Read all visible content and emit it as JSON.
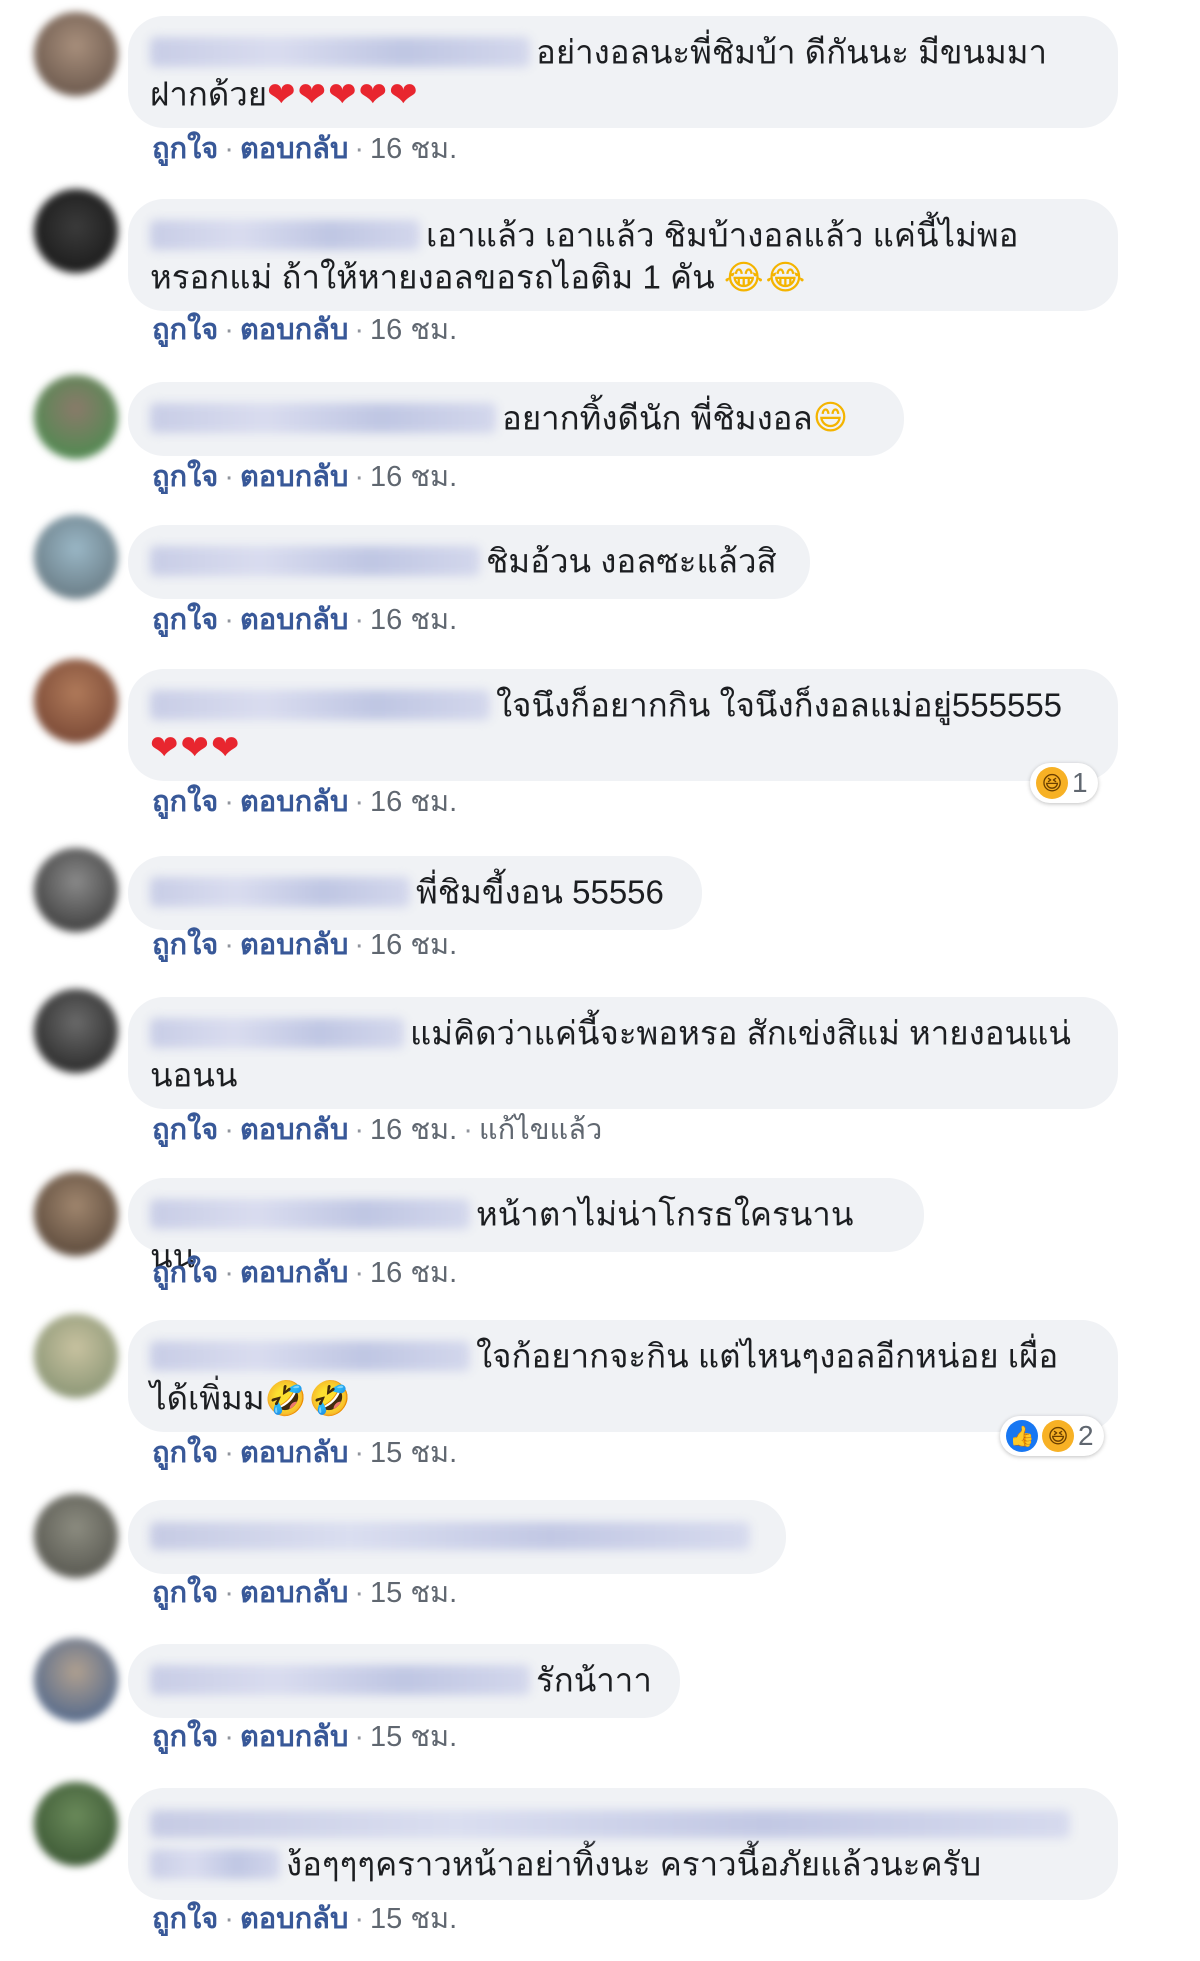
{
  "actions": {
    "like": "ถูกใจ",
    "reply": "ตอบกลับ",
    "separator": "·",
    "edited": "แก้ไขแล้ว"
  },
  "comments": [
    {
      "text": "อย่างอลนะพี่ชิมบ้า ดีกันนะ มีขนมมา",
      "text2": "ฝากด้วย",
      "emoji": "❤❤❤❤❤",
      "time": "16 ชม."
    },
    {
      "text": "เอาแล้ว เอาแล้ว ชิมบ้างอลแล้ว แค่นี้ไม่พอ",
      "text2": "หรอกแม่ ถ้าให้หายงอลขอรถไอติม 1 คัน",
      "emoji": "😂😂",
      "time": "16 ชม."
    },
    {
      "text": "อยากทิ้งดีนัก พี่ชิมงอล",
      "emoji": "😄",
      "time": "16 ชม."
    },
    {
      "text": "ชิมอ้วน งอลซะแล้วสิ",
      "time": "16 ชม."
    },
    {
      "text": "ใจนึงก็อยากกิน ใจนึงก็งอลแม่อยู่555555",
      "emoji": "❤❤❤",
      "time": "16 ชม.",
      "reaction_count": "1"
    },
    {
      "text": "พี่ชิมขี้งอน 55556",
      "time": "16 ชม."
    },
    {
      "text": "แม่คิดว่าแค่นี้จะพอหรอ สักเข่งสิแม่ หายงอนแน่",
      "text2": "นอนน",
      "time": "16 ชม."
    },
    {
      "text": "หน้าตาไม่น่าโกรธใครนานนน",
      "time": "16 ชม."
    },
    {
      "text": "ใจก้อยากจะกิน แต่ไหนๆงอลอีกหน่อย เผื่อ",
      "text2": "ได้เพิ่มม",
      "emoji": "🤣🤣",
      "time": "15 ชม.",
      "reaction_count": "2"
    },
    {
      "time": "15 ชม."
    },
    {
      "text": "รักน้าาา",
      "time": "15 ชม."
    },
    {
      "text": "ง้อๆๆๆคราวหน้าอย่าทิ้งนะ คราวนี้อภัยแล้วนะครับ",
      "time": "15 ชม."
    }
  ],
  "icons": {
    "haha": "haha-reaction-icon",
    "like": "like-reaction-icon",
    "heart": "heart-emoji",
    "laugh": "laugh-emoji"
  },
  "colors": {
    "bubble": "#f0f2f5",
    "link": "#385898",
    "meta": "#606770",
    "heart": "#e8262f"
  }
}
